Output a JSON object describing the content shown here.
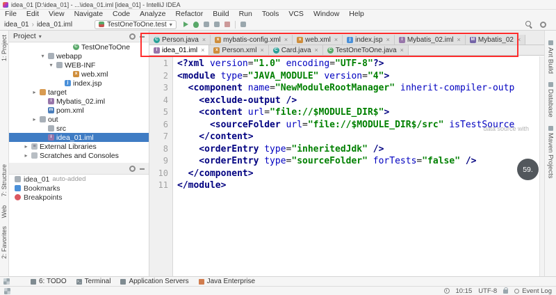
{
  "window": {
    "title": "idea_01 [D:\\idea_01] - ...\\idea_01.iml [idea_01] - IntelliJ IDEA"
  },
  "menu": {
    "items": [
      "File",
      "Edit",
      "View",
      "Navigate",
      "Code",
      "Analyze",
      "Refactor",
      "Build",
      "Run",
      "Tools",
      "VCS",
      "Window",
      "Help"
    ]
  },
  "toolbar": {
    "breadcrumb": [
      "idea_01",
      "idea_01.iml"
    ],
    "run_config": "TestOneToOne.test"
  },
  "left_stripe": {
    "items": [
      "1: Project",
      "7: Structure",
      "Web",
      "2: Favorites"
    ]
  },
  "right_stripe": {
    "items": [
      "Ant Build",
      "Database",
      "Maven Projects"
    ]
  },
  "project_panel": {
    "title": "Project",
    "tree": [
      {
        "label": "TestOneToOne",
        "icon": "class-green",
        "depth": 6,
        "arrow": ""
      },
      {
        "label": "webapp",
        "icon": "folder",
        "depth": 3,
        "arrow": "down"
      },
      {
        "label": "WEB-INF",
        "icon": "folder",
        "depth": 4,
        "arrow": "down"
      },
      {
        "label": "web.xml",
        "icon": "xml",
        "depth": 6,
        "arrow": ""
      },
      {
        "label": "index.jsp",
        "icon": "jsp",
        "depth": 5,
        "arrow": ""
      },
      {
        "label": "target",
        "icon": "folder-ex",
        "depth": 2,
        "arrow": "right"
      },
      {
        "label": "Mybatis_02.iml",
        "icon": "iml",
        "depth": 3,
        "arrow": ""
      },
      {
        "label": "pom.xml",
        "icon": "maven",
        "depth": 3,
        "arrow": ""
      },
      {
        "label": "out",
        "icon": "folder",
        "depth": 2,
        "arrow": "right"
      },
      {
        "label": "src",
        "icon": "folder",
        "depth": 3,
        "arrow": ""
      },
      {
        "label": "idea_01.iml",
        "icon": "iml",
        "depth": 3,
        "arrow": "",
        "selected": true
      },
      {
        "label": "External Libraries",
        "icon": "lib",
        "depth": 1,
        "arrow": "right"
      },
      {
        "label": "Scratches and Consoles",
        "icon": "scratch",
        "depth": 1,
        "arrow": "right"
      }
    ]
  },
  "favorites_panel": {
    "items": [
      {
        "label": "idea_01",
        "suffix": "auto-added",
        "icon": "folder-star"
      },
      {
        "label": "Bookmarks",
        "suffix": "",
        "icon": "bookmark"
      },
      {
        "label": "Breakpoints",
        "suffix": "",
        "icon": "breakpoint"
      }
    ]
  },
  "editor": {
    "tabs_row1": [
      {
        "label": "Person.java",
        "icon": "class"
      },
      {
        "label": "mybatis-config.xml",
        "icon": "xml"
      },
      {
        "label": "web.xml",
        "icon": "xml"
      },
      {
        "label": "index.jsp",
        "icon": "jsp"
      },
      {
        "label": "Mybatis_02.iml",
        "icon": "iml"
      },
      {
        "label": "Mybatis_02",
        "icon": "module"
      }
    ],
    "tabs_row2": [
      {
        "label": "idea_01.iml",
        "icon": "iml",
        "active": true
      },
      {
        "label": "Person.xml",
        "icon": "xml"
      },
      {
        "label": "Card.java",
        "icon": "class"
      },
      {
        "label": "TestOneToOne.java",
        "icon": "class-green"
      }
    ],
    "lines": [
      [
        [
          "t",
          "<?xml "
        ],
        [
          "a",
          "version"
        ],
        [
          "p",
          "="
        ],
        [
          "v",
          "\"1.0\""
        ],
        [
          "p",
          " "
        ],
        [
          "a",
          "encoding"
        ],
        [
          "p",
          "="
        ],
        [
          "v",
          "\"UTF-8\""
        ],
        [
          "t",
          "?>"
        ]
      ],
      [
        [
          "t",
          "<module "
        ],
        [
          "a",
          "type"
        ],
        [
          "p",
          "="
        ],
        [
          "v",
          "\"JAVA_MODULE\""
        ],
        [
          "p",
          " "
        ],
        [
          "a",
          "version"
        ],
        [
          "p",
          "="
        ],
        [
          "v",
          "\"4\""
        ],
        [
          "t",
          ">"
        ]
      ],
      [
        [
          "t",
          "  <component "
        ],
        [
          "a",
          "name"
        ],
        [
          "p",
          "="
        ],
        [
          "v",
          "\"NewModuleRootManager\""
        ],
        [
          "p",
          " "
        ],
        [
          "a",
          "inherit-compiler-outp"
        ]
      ],
      [
        [
          "t",
          "    <exclude-output />"
        ]
      ],
      [
        [
          "t",
          "    <content "
        ],
        [
          "a",
          "url"
        ],
        [
          "p",
          "="
        ],
        [
          "v",
          "\"file://$MODULE_DIR$\""
        ],
        [
          "t",
          ">"
        ]
      ],
      [
        [
          "t",
          "      <sourceFolder "
        ],
        [
          "a",
          "url"
        ],
        [
          "p",
          "="
        ],
        [
          "v",
          "\"file://$MODULE_DIR$/src\""
        ],
        [
          "p",
          " "
        ],
        [
          "a",
          "isTestSource"
        ]
      ],
      [
        [
          "t",
          "    </content>"
        ]
      ],
      [
        [
          "t",
          "    <orderEntry "
        ],
        [
          "a",
          "type"
        ],
        [
          "p",
          "="
        ],
        [
          "v",
          "\"inheritedJdk\""
        ],
        [
          "t",
          " />"
        ]
      ],
      [
        [
          "t",
          "    <orderEntry "
        ],
        [
          "a",
          "type"
        ],
        [
          "p",
          "="
        ],
        [
          "v",
          "\"sourceFolder\""
        ],
        [
          "p",
          " "
        ],
        [
          "a",
          "forTests"
        ],
        [
          "p",
          "="
        ],
        [
          "v",
          "\"false\""
        ],
        [
          "t",
          " />"
        ]
      ],
      [
        [
          "t",
          "  </component>"
        ]
      ],
      [
        [
          "t",
          "</module>"
        ]
      ]
    ]
  },
  "overlay": {
    "annotation_color": "#ff2d2d",
    "progress_badge": "59.",
    "ghost_text": "data source with"
  },
  "bottom_bar": {
    "items": [
      {
        "label": "6: TODO",
        "icon": "todo"
      },
      {
        "label": "Terminal",
        "icon": "terminal"
      },
      {
        "label": "Application Servers",
        "icon": "server"
      },
      {
        "label": "Java Enterprise",
        "icon": "java"
      }
    ]
  },
  "status_bar": {
    "time": "10:15",
    "encoding": "UTF-8",
    "event_log": "Event Log"
  }
}
